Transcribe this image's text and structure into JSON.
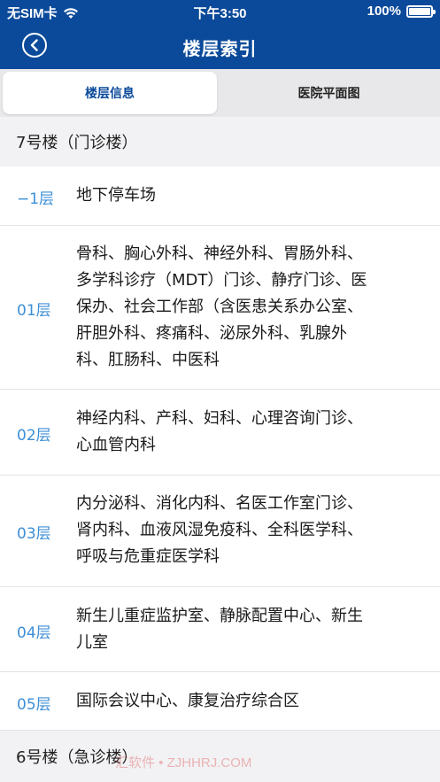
{
  "status": {
    "carrier": "无SIM卡",
    "time": "下午3:50",
    "battery": "100%",
    "battery_level": 1.0
  },
  "nav": {
    "title": "楼层索引",
    "back_icon": "chevron-left-circle"
  },
  "tabs": [
    {
      "label": "楼层信息",
      "active": true
    },
    {
      "label": "医院平面图",
      "active": false
    }
  ],
  "sections": [
    {
      "title": "7号楼（门诊楼）"
    },
    {
      "title": "6号楼（急诊楼）"
    }
  ],
  "floors": [
    {
      "floor": "−1层",
      "desc": "地下停车场"
    },
    {
      "floor": "01层",
      "desc": "骨科、胸心外科、神经外科、胃肠外科、多学科诊疗（MDT）门诊、静疗门诊、医保办、社会工作部（含医患关系办公室、肝胆外科、疼痛科、泌尿外科、乳腺外科、肛肠科、中医科"
    },
    {
      "floor": "02层",
      "desc": "神经内科、产科、妇科、心理咨询门诊、心血管内科"
    },
    {
      "floor": "03层",
      "desc": "内分泌科、消化内科、名医工作室门诊、肾内科、血液风湿免疫科、全科医学科、呼吸与危重症医学科"
    },
    {
      "floor": "04层",
      "desc": "新生儿重症监护室、静脉配置中心、新生儿室"
    },
    {
      "floor": "05层",
      "desc": "国际会议中心、康复治疗综合区"
    }
  ],
  "watermark": "汇软件 • ZJHHRJ.COM"
}
